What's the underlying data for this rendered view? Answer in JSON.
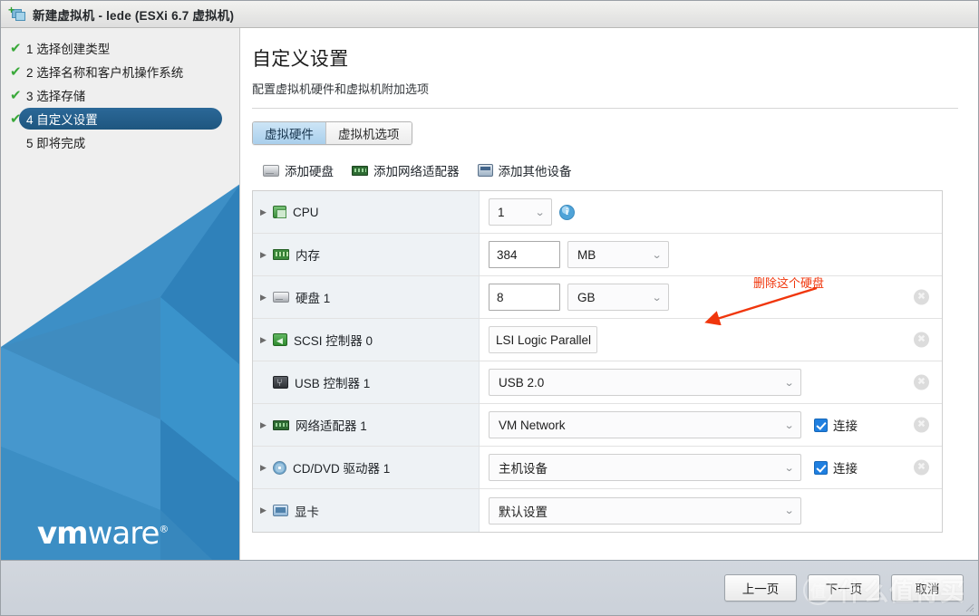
{
  "window": {
    "title": "新建虚拟机 - lede (ESXi 6.7 虚拟机)",
    "icon": "new-vm-icon"
  },
  "sidebar": {
    "steps": [
      {
        "num": "1",
        "label": "选择创建类型",
        "done": true,
        "active": false,
        "check": "✔"
      },
      {
        "num": "2",
        "label": "选择名称和客户机操作系统",
        "done": true,
        "active": false,
        "check": "✔"
      },
      {
        "num": "3",
        "label": "选择存储",
        "done": true,
        "active": false,
        "check": "✔"
      },
      {
        "num": "4",
        "label": "自定义设置",
        "done": true,
        "active": true,
        "check": "✔"
      },
      {
        "num": "5",
        "label": "即将完成",
        "done": false,
        "active": false,
        "check": ""
      }
    ],
    "logo": {
      "bold": "vm",
      "light": "ware",
      "reg": "®"
    },
    "accent_color": "#3383c4"
  },
  "main": {
    "title": "自定义设置",
    "subtitle": "配置虚拟机硬件和虚拟机附加选项",
    "tabs": [
      {
        "label": "虚拟硬件",
        "active": true
      },
      {
        "label": "虚拟机选项",
        "active": false
      }
    ],
    "toolbar": [
      {
        "label": "添加硬盘",
        "icon": "hard-disk-icon"
      },
      {
        "label": "添加网络适配器",
        "icon": "network-adapter-icon"
      },
      {
        "label": "添加其他设备",
        "icon": "other-device-icon"
      }
    ],
    "devices": [
      {
        "label": "CPU",
        "icon": "cpu-icon",
        "expandable": true,
        "control": "select",
        "value": "1",
        "info": true,
        "removable": false
      },
      {
        "label": "内存",
        "icon": "memory-icon",
        "expandable": true,
        "control": "number-unit",
        "value": "384",
        "unit": "MB",
        "removable": false
      },
      {
        "label": "硬盘 1",
        "icon": "hard-disk-icon",
        "expandable": true,
        "control": "number-unit",
        "value": "8",
        "unit": "GB",
        "removable": true
      },
      {
        "label": "SCSI 控制器 0",
        "icon": "scsi-controller-icon",
        "expandable": true,
        "control": "readonly",
        "value": "LSI Logic Parallel",
        "removable": true
      },
      {
        "label": "USB 控制器 1",
        "icon": "usb-controller-icon",
        "expandable": false,
        "control": "select-wide",
        "value": "USB 2.0",
        "removable": true
      },
      {
        "label": "网络适配器 1",
        "icon": "network-adapter-icon",
        "expandable": true,
        "control": "select-wide",
        "value": "VM Network",
        "checkbox": {
          "label": "连接",
          "checked": true
        },
        "removable": true
      },
      {
        "label": "CD/DVD 驱动器 1",
        "icon": "cd-dvd-icon",
        "expandable": true,
        "control": "select-wide",
        "value": "主机设备",
        "checkbox": {
          "label": "连接",
          "checked": true
        },
        "removable": true
      },
      {
        "label": "显卡",
        "icon": "video-card-icon",
        "expandable": true,
        "control": "select-wide",
        "value": "默认设置",
        "removable": false
      }
    ]
  },
  "annotation": {
    "text": "删除这个硬盘",
    "color": "#f0360c",
    "points_to": "硬盘 1 的删除按钮"
  },
  "footer": {
    "buttons": [
      {
        "label": "上一页"
      },
      {
        "label": "下一页"
      },
      {
        "label": "取消"
      }
    ]
  },
  "watermark": {
    "badge": "值",
    "text": "什么值得买"
  }
}
